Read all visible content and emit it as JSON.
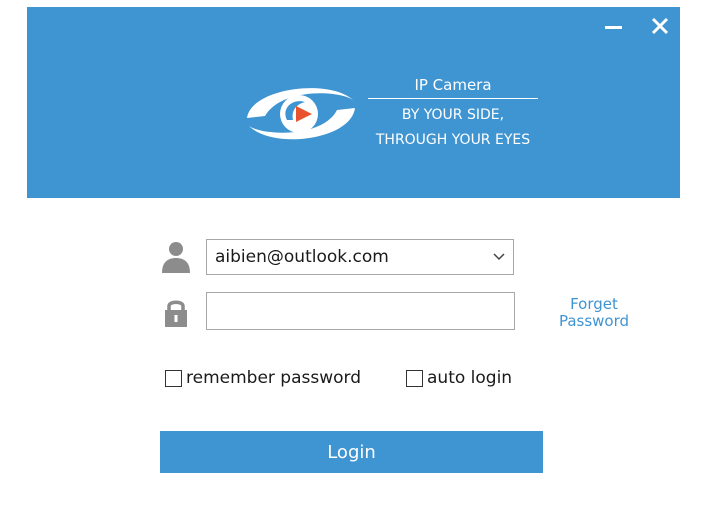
{
  "header": {
    "logo_icon": "ip-camera-eye-logo",
    "product_name": "IP Camera",
    "tagline_line1": "BY YOUR SIDE,",
    "tagline_line2": "THROUGH YOUR EYES",
    "background_color": "#3f94d2"
  },
  "window_controls": {
    "minimize_icon": "minimize-icon",
    "close_icon": "close-icon"
  },
  "login_form": {
    "user_icon": "user-icon",
    "lock_icon": "lock-icon",
    "account_value": "aibien@outlook.com",
    "password_value": "",
    "password_placeholder": "",
    "forget_password_line1": "Forget",
    "forget_password_line2": "Password",
    "remember_password_label": "remember password",
    "remember_password_checked": false,
    "auto_login_label": "auto login",
    "auto_login_checked": false,
    "login_button_label": "Login",
    "accent_color": "#3f94d2"
  }
}
